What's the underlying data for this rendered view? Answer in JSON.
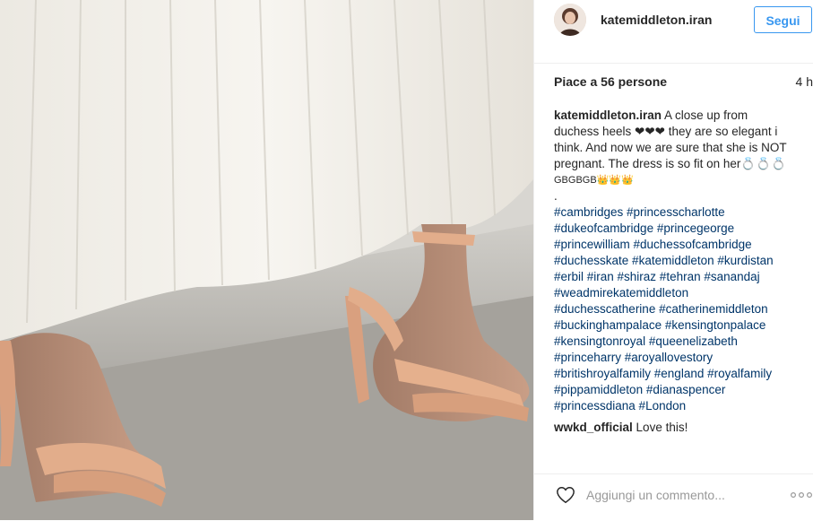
{
  "post": {
    "username": "katemiddleton.iran",
    "follow_label": "Segui",
    "likes": "Piace a 56 persone",
    "time": "4 h",
    "caption_lines": [
      "A close up from",
      "duchess heels ❤❤❤ they are so elegant i",
      "think. And now we are sure that she is NOT",
      "pregnant. The dress is so fit on her💍💍💍",
      "GBGBGB👑👑👑",
      "."
    ],
    "hashtags": [
      "#cambridges #princesscharlotte",
      "#dukeofcambridge #princegeorge",
      "#princewilliam #duchessofcambridge",
      "#duchesskate #katemiddleton #kurdistan",
      "#erbil #iran #shiraz #tehran #sanandaj",
      "#weadmirekatemiddleton",
      "#duchesscatherine #catherinemiddleton",
      "#buckinghampalace #kensingtonpalace",
      "#kensingtonroyal #queenelizabeth",
      "#princeharry #aroyallovestory",
      "#britishroyalfamily #england #royalfamily",
      "#pippamiddleton #dianaspencer",
      "#princessdiana #London"
    ],
    "comments": [
      {
        "username": "wwkd_official",
        "text": "Love this!"
      }
    ],
    "comment_placeholder": "Aggiungi un commento...",
    "icons": {
      "like": "heart-icon",
      "more": "more-options-icon"
    },
    "colors": {
      "accent": "#3897f0",
      "hashtag": "#003569"
    }
  }
}
